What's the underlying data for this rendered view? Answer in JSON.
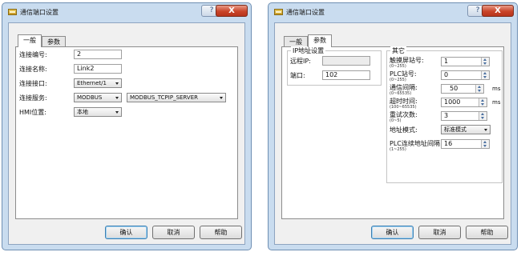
{
  "window1": {
    "title": "通信端口设置",
    "help_glyph": "?",
    "close_glyph": "X",
    "tabs": [
      "一般",
      "参数"
    ],
    "fields": {
      "conn_no_label": "连接编号:",
      "conn_no_value": "2",
      "conn_name_label": "连接名称:",
      "conn_name_value": "Link2",
      "conn_port_label": "连接接口:",
      "conn_port_value": "Ethernet/1",
      "conn_service_label": "连接服务:",
      "conn_service_value": "MODBUS",
      "conn_service_value2": "MODBUS_TCPIP_SERVER",
      "hmi_pos_label": "HMI位置:",
      "hmi_pos_value": "本地"
    },
    "buttons": {
      "ok": "确认",
      "cancel": "取消",
      "help": "帮助"
    }
  },
  "window2": {
    "title": "通信端口设置",
    "help_glyph": "?",
    "close_glyph": "X",
    "tabs": [
      "一般",
      "参数"
    ],
    "ip_group": {
      "title": "IP地址设置",
      "remote_ip_label": "远程IP:",
      "remote_ip_value": "",
      "port_label": "端口:",
      "port_value": "102"
    },
    "other_group": {
      "title": "其它",
      "touch_station_label": "触摸屏站号:",
      "touch_station_range": "(0~255)",
      "touch_station_value": "1",
      "plc_station_label": "PLC站号:",
      "plc_station_range": "(0~255)",
      "plc_station_value": "0",
      "comm_interval_label": "通信间隔:",
      "comm_interval_range": "(0~65535)",
      "comm_interval_value": "50",
      "comm_interval_unit": "ms",
      "timeout_label": "超时时间:",
      "timeout_range": "(100~65535)",
      "timeout_value": "1000",
      "timeout_unit": "ms",
      "retry_label": "重试次数:",
      "retry_range": "(0~5)",
      "retry_value": "3",
      "addr_mode_label": "地址模式:",
      "addr_mode_value": "标准模式",
      "plc_addr_gap_label": "PLC连续地址间隔",
      "plc_addr_gap_range": "(1~255)",
      "plc_addr_gap_value": "16"
    },
    "buttons": {
      "ok": "确认",
      "cancel": "取消",
      "help": "帮助"
    }
  }
}
